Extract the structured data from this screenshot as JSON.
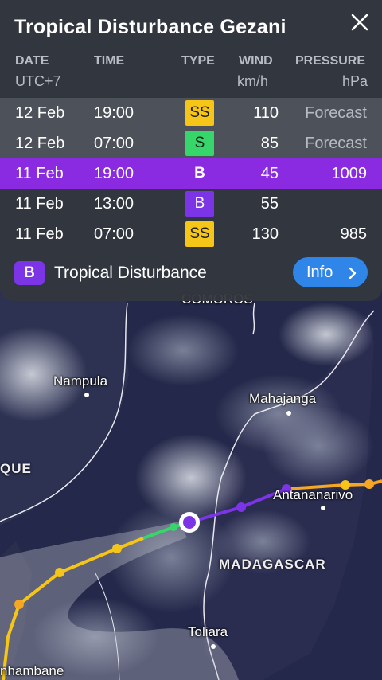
{
  "storm": {
    "title": "Tropical Disturbance Gezani"
  },
  "columns": {
    "date": "DATE",
    "time": "TIME",
    "type": "TYPE",
    "wind": "WIND",
    "pressure": "PRESSURE",
    "tz": "UTC+7",
    "wind_unit": "km/h",
    "pressure_unit": "hPa"
  },
  "rows": [
    {
      "date": "12 Feb",
      "time": "19:00",
      "type": "SS",
      "wind": "110",
      "pressure": "Forecast",
      "type_color": "#f5c518",
      "forecast": true
    },
    {
      "date": "12 Feb",
      "time": "07:00",
      "type": "S",
      "wind": "85",
      "pressure": "Forecast",
      "type_color": "#36d66b",
      "forecast": true
    },
    {
      "date": "11 Feb",
      "time": "19:00",
      "type": "B",
      "wind": "45",
      "pressure": "1009",
      "type_color": "#7b35e6",
      "selected": true
    },
    {
      "date": "11 Feb",
      "time": "13:00",
      "type": "B",
      "wind": "55",
      "pressure": "",
      "type_color": "#7b35e6"
    },
    {
      "date": "11 Feb",
      "time": "07:00",
      "type": "SS",
      "wind": "130",
      "pressure": "985",
      "type_color": "#f5c518"
    }
  ],
  "legend": {
    "badge": "B",
    "label": "Tropical Disturbance",
    "color": "#7b35e6"
  },
  "info_button": {
    "label": "Info",
    "icon": "chevron-right-icon"
  },
  "close_icon": "close-icon",
  "map": {
    "cities": {
      "nampula": "Nampula",
      "mahajanga": "Mahajanga",
      "antananarivo": "Antananarivo",
      "toliara": "Toliara",
      "inhambane": "nhambane",
      "comoros": "COMOROS"
    },
    "countries": {
      "madagascar": "MADAGASCAR",
      "mozambique": "QUE"
    }
  },
  "colors": {
    "selected_row": "#8a2be2",
    "accent": "#2f86e8",
    "panel": "#34373e"
  }
}
